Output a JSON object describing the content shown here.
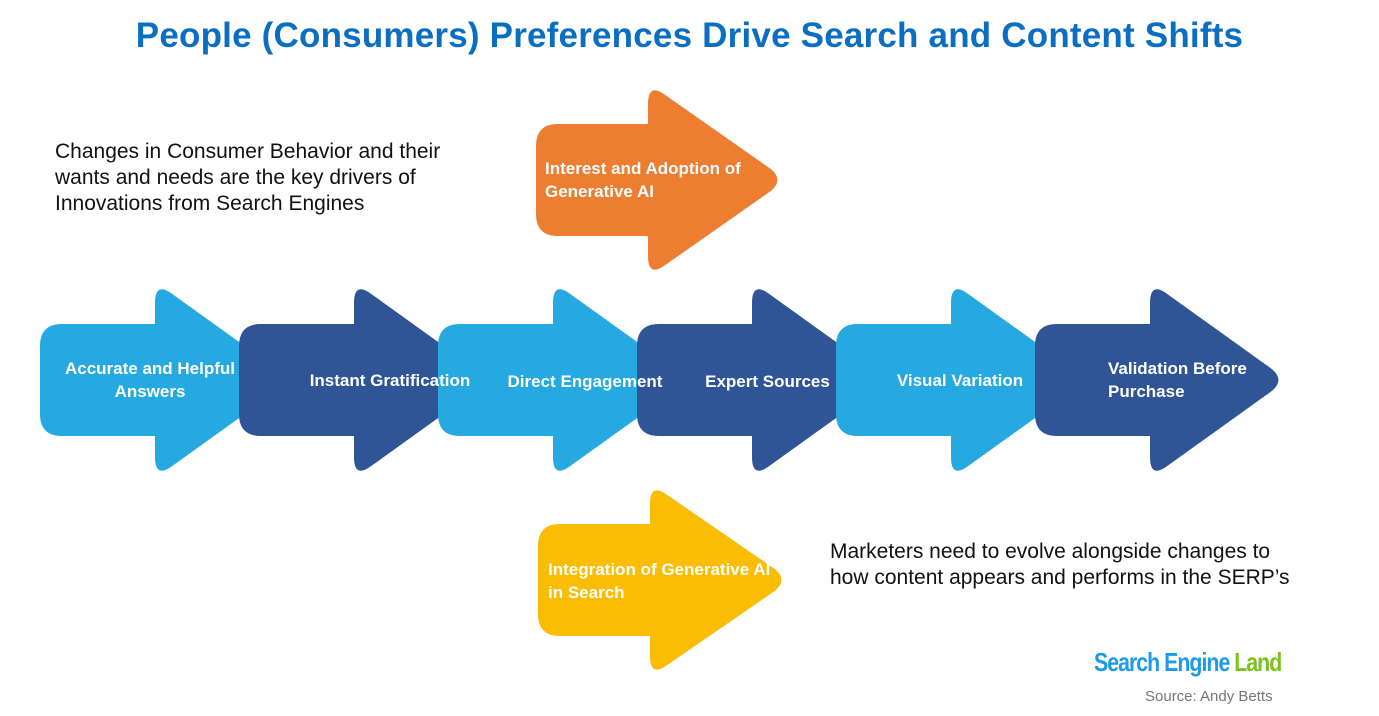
{
  "title": "People (Consumers) Preferences Drive Search and Content Shifts",
  "notes": {
    "top_left": "Changes in Consumer Behavior and their wants and needs are the key drivers of Innovations from Search Engines",
    "bottom_right": "Marketers need to evolve alongside changes to how content appears and performs in the SERP’s"
  },
  "colors": {
    "title": "#0a6fc2",
    "light_blue": "#25a9e0",
    "dark_blue": "#2f5597",
    "orange": "#ed7d31",
    "yellow": "#fbbc04"
  },
  "chain": [
    {
      "label": "Accurate and Helpful Answers",
      "color": "light_blue"
    },
    {
      "label": "Instant Gratification",
      "color": "dark_blue"
    },
    {
      "label": "Direct Engagement",
      "color": "light_blue"
    },
    {
      "label": "Expert Sources",
      "color": "dark_blue"
    },
    {
      "label": "Visual Variation",
      "color": "light_blue"
    },
    {
      "label": "Validation Before Purchase",
      "color": "dark_blue"
    }
  ],
  "side_arrows": {
    "top": {
      "label": "Interest and Adoption of Generative AI",
      "color": "orange"
    },
    "bottom": {
      "label": "Integration of Generative AI in Search",
      "color": "yellow"
    }
  },
  "logo": {
    "part1": "Search Engine ",
    "part2": "Land"
  },
  "source": "Source: Andy Betts"
}
